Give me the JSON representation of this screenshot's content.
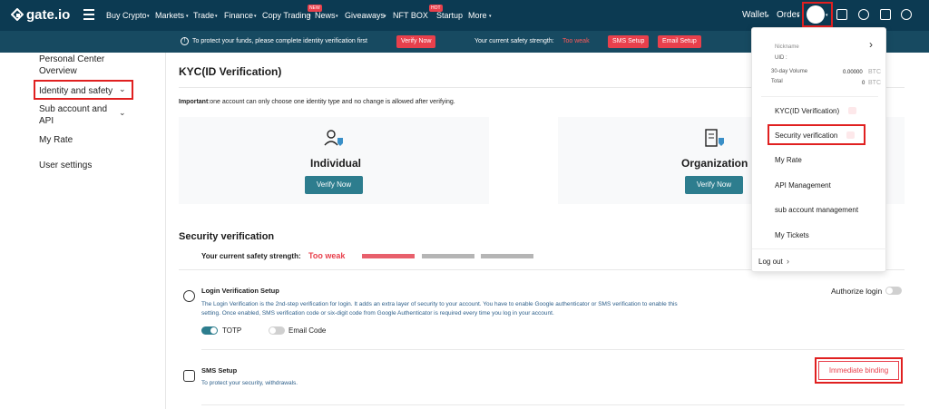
{
  "brand": "gate.io",
  "nav": {
    "items": [
      "Buy Crypto",
      "Markets",
      "Trade",
      "Finance",
      "Copy Trading",
      "News",
      "Giveaways",
      "NFT BOX",
      "Startup",
      "More"
    ],
    "badge_new": "NEW",
    "badge_hot": "HOT",
    "wallet": "Wallet",
    "order": "Order"
  },
  "notice": {
    "message": "To protect your funds, please complete identity verification first",
    "verify_now": "Verify Now",
    "strength_label": "Your current safety strength:",
    "strength_value": "Too weak",
    "sms_setup": "SMS Setup",
    "email_setup": "Email Setup"
  },
  "sidebar": {
    "items": [
      {
        "label": "Personal Center Overview"
      },
      {
        "label": "Identity and safety"
      },
      {
        "label": "Sub account and API"
      },
      {
        "label": "My Rate"
      },
      {
        "label": "User settings"
      }
    ]
  },
  "kyc": {
    "title": "KYC(ID Verification)",
    "important_bold": "Important",
    "important_text": ":one account can only choose one identity type and no change is allowed after verifying.",
    "individual": "Individual",
    "organization": "Organization",
    "verify_now": "Verify Now"
  },
  "security": {
    "title": "Security verification",
    "strength_label": "Your current safety strength:",
    "strength_value": "Too weak",
    "strength_level": 1,
    "strength_colors": [
      "#e8606c",
      "#b5b5b5",
      "#b5b5b5"
    ],
    "login": {
      "title": "Login Verification Setup",
      "desc": "The Login Verification is the 2nd-step verification for login. It adds an extra layer of security to your account. You have to enable Google authenticator or SMS verification to enable this setting. Once enabled, SMS verification code or six-digit code from Google Authenticator is required every time you log in your account.",
      "authorize": "Authorize login",
      "totp": "TOTP",
      "email_code": "Email Code"
    },
    "sms": {
      "title": "SMS Setup",
      "desc": "To protect your security, withdrawals.",
      "button": "Immediate binding"
    }
  },
  "dropdown": {
    "nickname_label": "Nickname",
    "uid_label": "UID :",
    "volume_label": "30-day Volume",
    "volume_value": "0.00000",
    "volume_unit": "BTC",
    "total_label": "Total",
    "total_value": "0",
    "total_unit": "BTC",
    "items": [
      "KYC(ID Verification)",
      "Security verification",
      "My Rate",
      "API Management",
      "sub account management",
      "My Tickets"
    ],
    "logout": "Log out"
  },
  "colors": {
    "nav_bg": "#0c3a52",
    "notice_bg": "#174a61",
    "accent": "#2d7d8e",
    "danger": "#e8404c",
    "highlight_box": "#e02020"
  }
}
